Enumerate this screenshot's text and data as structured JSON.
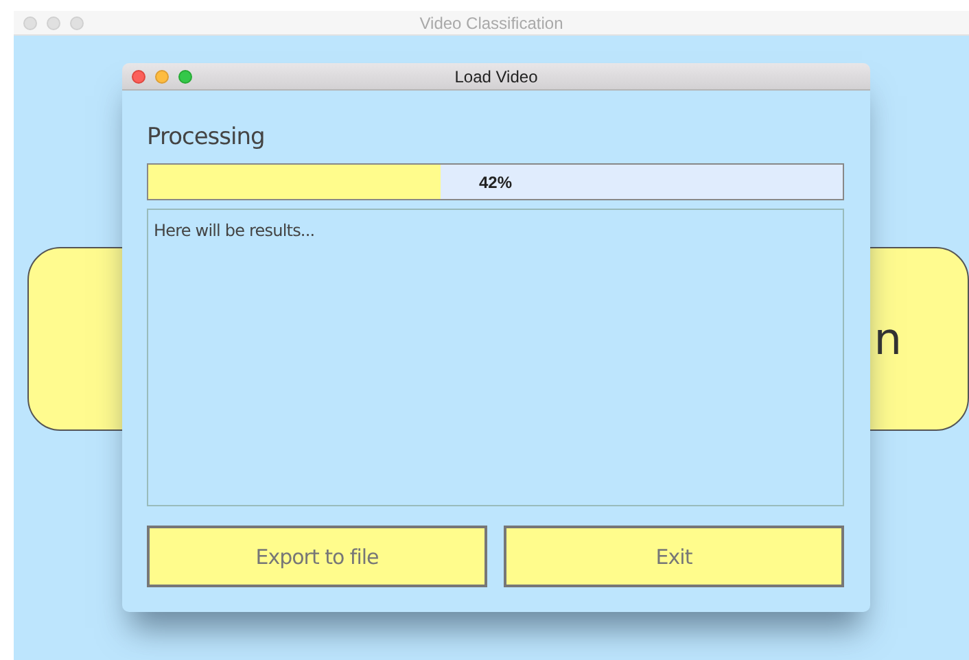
{
  "main_window": {
    "title": "Video Classification",
    "background_button": {
      "visible_text": "n"
    }
  },
  "dialog": {
    "title": "Load Video",
    "heading": "Processing",
    "progress": {
      "level": 0.42,
      "reading": "42%"
    },
    "results": {
      "value": "Here will be results..."
    },
    "buttons": [
      {
        "label": "Export to file"
      },
      {
        "label": "Exit"
      }
    ]
  }
}
